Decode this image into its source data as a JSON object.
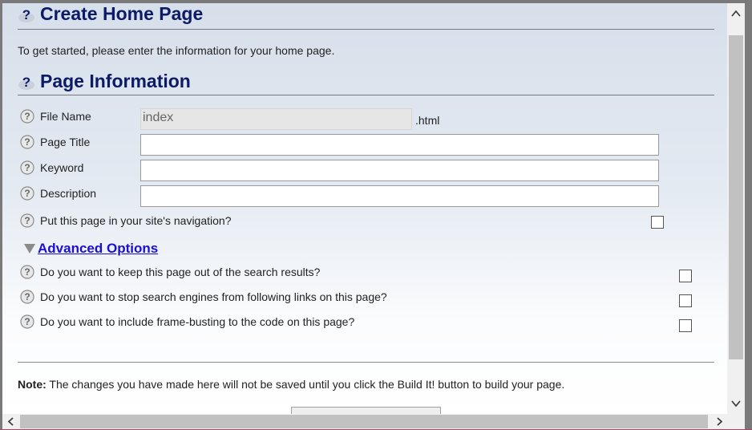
{
  "header": {
    "title": "Create Home Page",
    "intro": "To get started, please enter the information for your home page."
  },
  "page_info": {
    "title": "Page Information",
    "file_name": {
      "label": "File Name",
      "value": "index",
      "suffix": ".html"
    },
    "page_title": {
      "label": "Page Title",
      "value": ""
    },
    "keyword": {
      "label": "Keyword",
      "value": ""
    },
    "description": {
      "label": "Description",
      "value": ""
    },
    "navigation": {
      "label": "Put this page in your site's navigation?",
      "checked": false
    }
  },
  "advanced": {
    "label": "Advanced Options",
    "expanded": true,
    "options": [
      {
        "label": "Do you want to keep this page out of the search results?",
        "checked": false
      },
      {
        "label": "Do you want to stop search engines from following links on this page?",
        "checked": false
      },
      {
        "label": "Do you want to include frame-busting to the code on this page?",
        "checked": false
      }
    ]
  },
  "note": {
    "prefix": "Note:",
    "text": " The changes you have made here will not be saved until you click the Build It! button to build your page."
  },
  "colors": {
    "heading": "#0d1a66",
    "link": "#1a0fd4"
  }
}
